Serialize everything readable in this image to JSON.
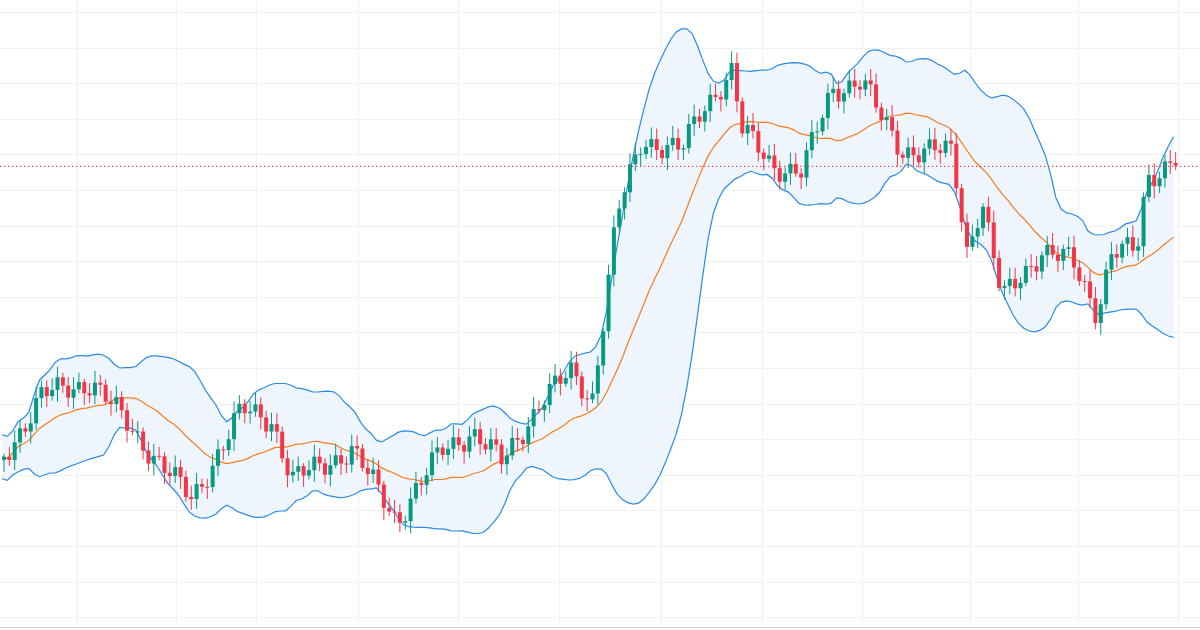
{
  "chart": {
    "kind": "candlestick",
    "bollinger_bands": true,
    "moving_average": true,
    "last_price_line": true
  }
}
